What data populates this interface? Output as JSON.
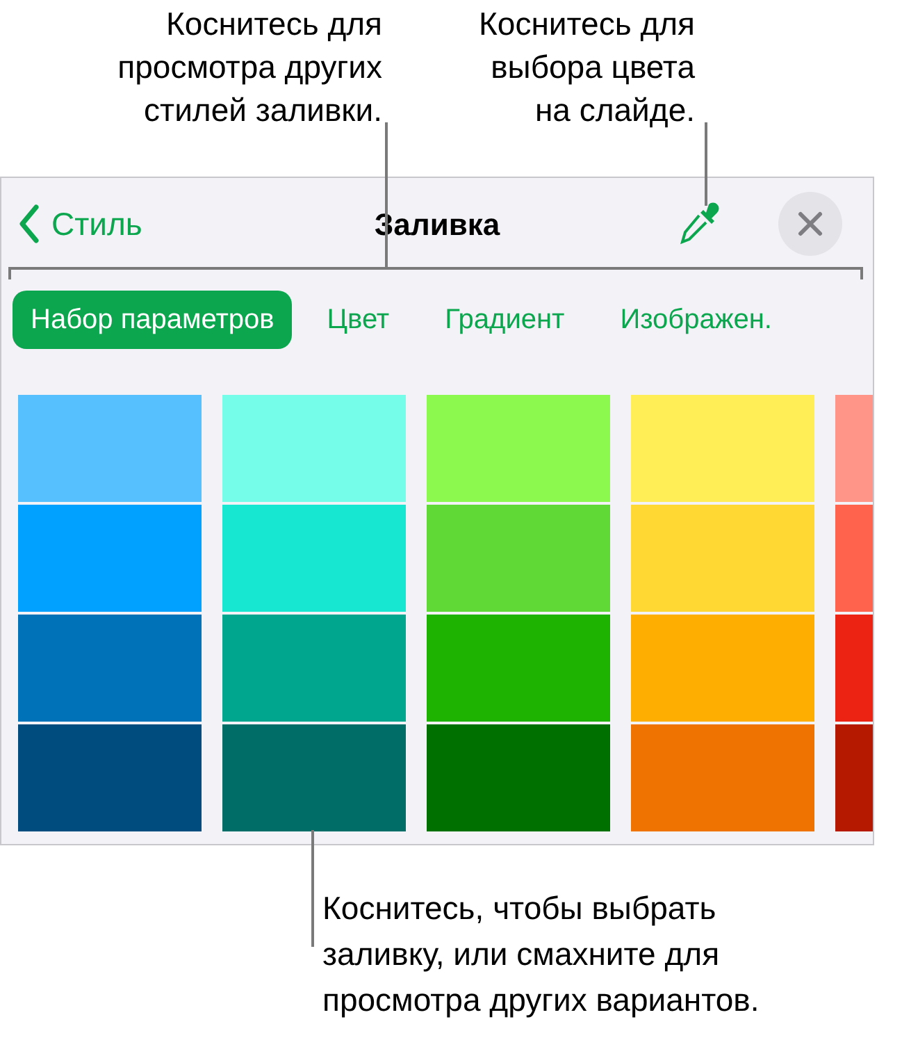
{
  "callouts": {
    "tabs": "Коснитесь для\nпросмотра других\nстилей заливки.",
    "eyedropper": "Коснитесь для\nвыбора цвета\nна слайде.",
    "swatches": "Коснитесь, чтобы выбрать\nзаливку, или смахните для\nпросмотра других вариантов."
  },
  "header": {
    "back": "Стиль",
    "title": "Заливка"
  },
  "tabs": [
    {
      "label": "Набор параметров",
      "selected": true
    },
    {
      "label": "Цвет",
      "selected": false
    },
    {
      "label": "Градиент",
      "selected": false
    },
    {
      "label": "Изображен.",
      "selected": false
    }
  ],
  "swatch_columns": [
    {
      "cells": [
        {
          "color": "#56bffe"
        },
        {
          "color": "#01a2ff"
        },
        {
          "color": "#0073b8"
        },
        {
          "color": "#014c7e"
        }
      ]
    },
    {
      "cells": [
        {
          "color": "#76fde9"
        },
        {
          "color": "#17e6d0"
        },
        {
          "color": "#00a78e"
        },
        {
          "color": "#006d66"
        }
      ]
    },
    {
      "cells": [
        {
          "color": "#8bf94e"
        },
        {
          "color": "#60d937"
        },
        {
          "color": "#1eb301"
        },
        {
          "color": "#007100"
        }
      ]
    },
    {
      "cells": [
        {
          "color": "#ffee56"
        },
        {
          "color": "#ffd834"
        },
        {
          "color": "#feae01"
        },
        {
          "color": "#ef7300"
        }
      ]
    },
    {
      "cells": [
        {
          "color": "#ff9488"
        },
        {
          "color": "#ff634e"
        },
        {
          "color": "#ec2213"
        },
        {
          "color": "#b51900"
        }
      ]
    }
  ]
}
